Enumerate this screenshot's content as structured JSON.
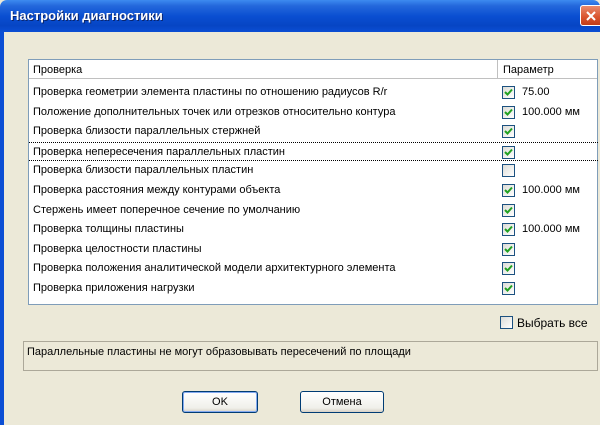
{
  "window": {
    "title": "Настройки диагностики"
  },
  "grid": {
    "col_check": "Проверка",
    "col_param": "Параметр",
    "rows": [
      {
        "name": "Проверка геометрии элемента пластины по отношению радиусов R/r",
        "checked": true,
        "value": "75.00"
      },
      {
        "name": "Положение дополнительных точек или отрезков относительно контура",
        "checked": true,
        "value": "100.000 мм"
      },
      {
        "name": "Проверка близости параллельных стержней",
        "checked": true,
        "value": ""
      },
      {
        "name": "Проверка непересечения параллельных пластин",
        "checked": true,
        "value": ""
      },
      {
        "name": "Проверка близости параллельных пластин",
        "checked": false,
        "value": ""
      },
      {
        "name": "Проверка расстояния между контурами объекта",
        "checked": true,
        "value": "100.000 мм"
      },
      {
        "name": "Стержень имеет поперечное сечение по умолчанию",
        "checked": true,
        "value": ""
      },
      {
        "name": "Проверка толщины пластины",
        "checked": true,
        "value": "100.000 мм"
      },
      {
        "name": "Проверка целостности пластины",
        "checked": true,
        "value": ""
      },
      {
        "name": "Проверка положения аналитической модели архитектурного элемента",
        "checked": true,
        "value": ""
      },
      {
        "name": "Проверка приложения нагрузки",
        "checked": true,
        "value": ""
      }
    ]
  },
  "select_all": {
    "label": "Выбрать все",
    "checked": false
  },
  "description": "Параллельные пластины не могут образовывать пересечений по площади",
  "buttons": {
    "ok": "OK",
    "cancel": "Отмена"
  },
  "colors": {
    "title_bar": "#0a4fd2",
    "check": "#21a121",
    "face": "#ece9d8"
  }
}
